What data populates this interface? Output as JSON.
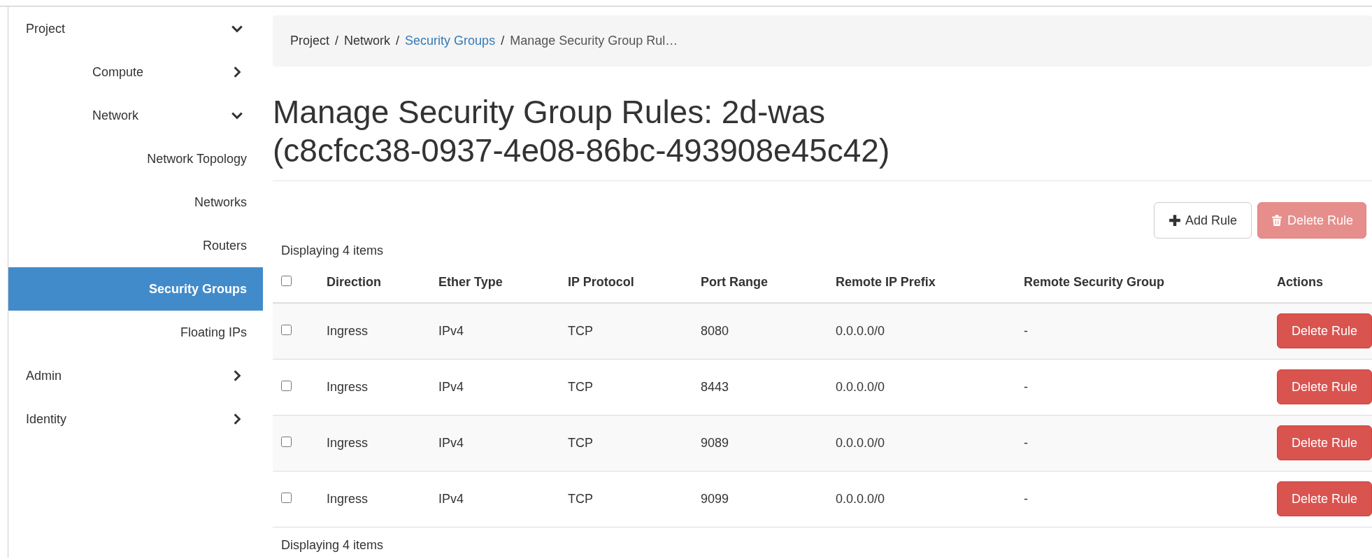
{
  "sidebar": {
    "items": [
      {
        "label": "Project",
        "expanded": true,
        "selected": false,
        "children": [
          {
            "label": "Compute",
            "expanded": false,
            "selected": false
          },
          {
            "label": "Network",
            "expanded": true,
            "selected": false,
            "children": [
              {
                "label": "Network Topology",
                "selected": false
              },
              {
                "label": "Networks",
                "selected": false
              },
              {
                "label": "Routers",
                "selected": false
              },
              {
                "label": "Security Groups",
                "selected": true
              },
              {
                "label": "Floating IPs",
                "selected": false
              }
            ]
          }
        ]
      },
      {
        "label": "Admin",
        "expanded": false,
        "selected": false
      },
      {
        "label": "Identity",
        "expanded": false,
        "selected": false
      }
    ]
  },
  "breadcrumb": {
    "separator": "/",
    "items": [
      {
        "label": "Project",
        "kind": "text"
      },
      {
        "label": "Network",
        "kind": "text"
      },
      {
        "label": "Security Groups",
        "kind": "link"
      },
      {
        "label": "Manage Security Group Rul…",
        "kind": "current"
      }
    ]
  },
  "title": [
    "Manage Security Group Rules: 2d-was",
    "(c8cfcc38-0937-4e08-86bc-493908e45c42)"
  ],
  "toolbar": [
    {
      "label": "Add Rule",
      "kind": "add",
      "disabled": false
    },
    {
      "label": "Delete Rule",
      "kind": "delete",
      "disabled": true
    }
  ],
  "table": {
    "count_top": "Displaying 4 items",
    "count_bottom": "Displaying 4 items",
    "select_all": {
      "checked": false
    },
    "columns": [
      "Direction",
      "Ether Type",
      "IP Protocol",
      "Port Range",
      "Remote IP Prefix",
      "Remote Security Group",
      "Actions"
    ],
    "rows": [
      {
        "checked": false,
        "cells": [
          "Ingress",
          "IPv4",
          "TCP",
          "8080",
          "0.0.0.0/0",
          "-"
        ],
        "action": "Delete Rule"
      },
      {
        "checked": false,
        "cells": [
          "Ingress",
          "IPv4",
          "TCP",
          "8443",
          "0.0.0.0/0",
          "-"
        ],
        "action": "Delete Rule"
      },
      {
        "checked": false,
        "cells": [
          "Ingress",
          "IPv4",
          "TCP",
          "9089",
          "0.0.0.0/0",
          "-"
        ],
        "action": "Delete Rule"
      },
      {
        "checked": false,
        "cells": [
          "Ingress",
          "IPv4",
          "TCP",
          "9099",
          "0.0.0.0/0",
          "-"
        ],
        "action": "Delete Rule"
      }
    ]
  }
}
